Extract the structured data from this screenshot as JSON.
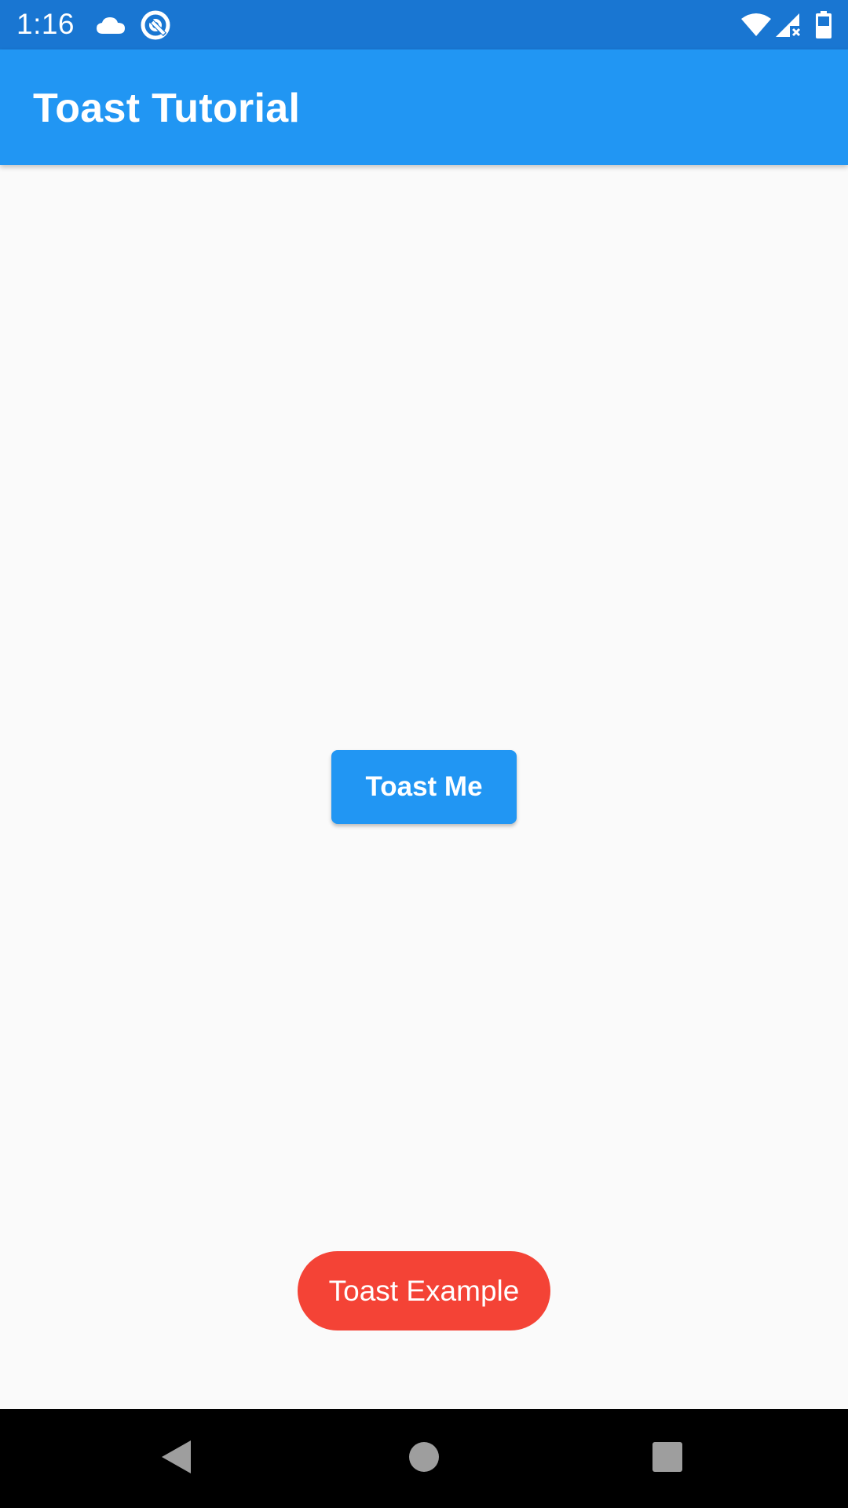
{
  "status_bar": {
    "time": "1:16",
    "left_icons": [
      "cloud-icon",
      "sync-icon"
    ],
    "right_icons": [
      "wifi-icon",
      "cell-signal-icon",
      "battery-icon"
    ],
    "color": "#1976d2"
  },
  "app_bar": {
    "title": "Toast Tutorial",
    "color": "#2196f3"
  },
  "main": {
    "button_label": "Toast Me",
    "button_color": "#2196f3"
  },
  "toast": {
    "message": "Toast Example",
    "color": "#f44336"
  },
  "nav_bar": {
    "buttons": [
      "back-icon",
      "home-icon",
      "recents-icon"
    ]
  }
}
